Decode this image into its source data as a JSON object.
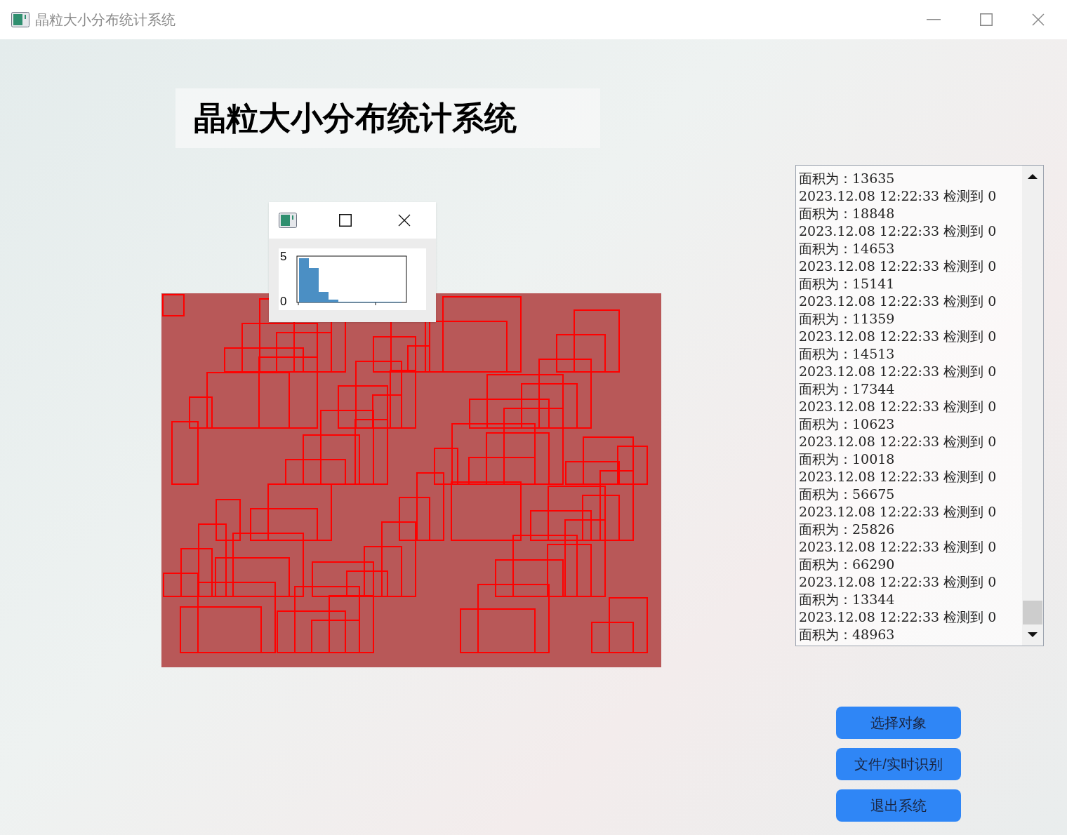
{
  "window": {
    "title": "晶粒大小分布统计系统"
  },
  "header": {
    "title": "晶粒大小分布统计系统"
  },
  "histogram_window": {
    "y_tick_labels": [
      "5",
      "0"
    ]
  },
  "log": {
    "lines": [
      "面积为：13635",
      "2023.12.08 12:22:33 检测到 0",
      "面积为：18848",
      "2023.12.08 12:22:33 检测到 0",
      "面积为：14653",
      "2023.12.08 12:22:33 检测到 0",
      "面积为：15141",
      "2023.12.08 12:22:33 检测到 0",
      "面积为：11359",
      "2023.12.08 12:22:33 检测到 0",
      "面积为：14513",
      "2023.12.08 12:22:33 检测到 0",
      "面积为：17344",
      "2023.12.08 12:22:33 检测到 0",
      "面积为：10623",
      "2023.12.08 12:22:33 检测到 0",
      "面积为：10018",
      "2023.12.08 12:22:33 检测到 0",
      "面积为：56675",
      "2023.12.08 12:22:33 检测到 0",
      "面积为：25826",
      "2023.12.08 12:22:33 检测到 0",
      "面积为：66290",
      "2023.12.08 12:22:33 检测到 0",
      "面积为：13344",
      "2023.12.08 12:22:33 检测到 0",
      "面积为：48963"
    ]
  },
  "buttons": [
    "选择对象",
    "文件/实时识别",
    "退出系统"
  ]
}
